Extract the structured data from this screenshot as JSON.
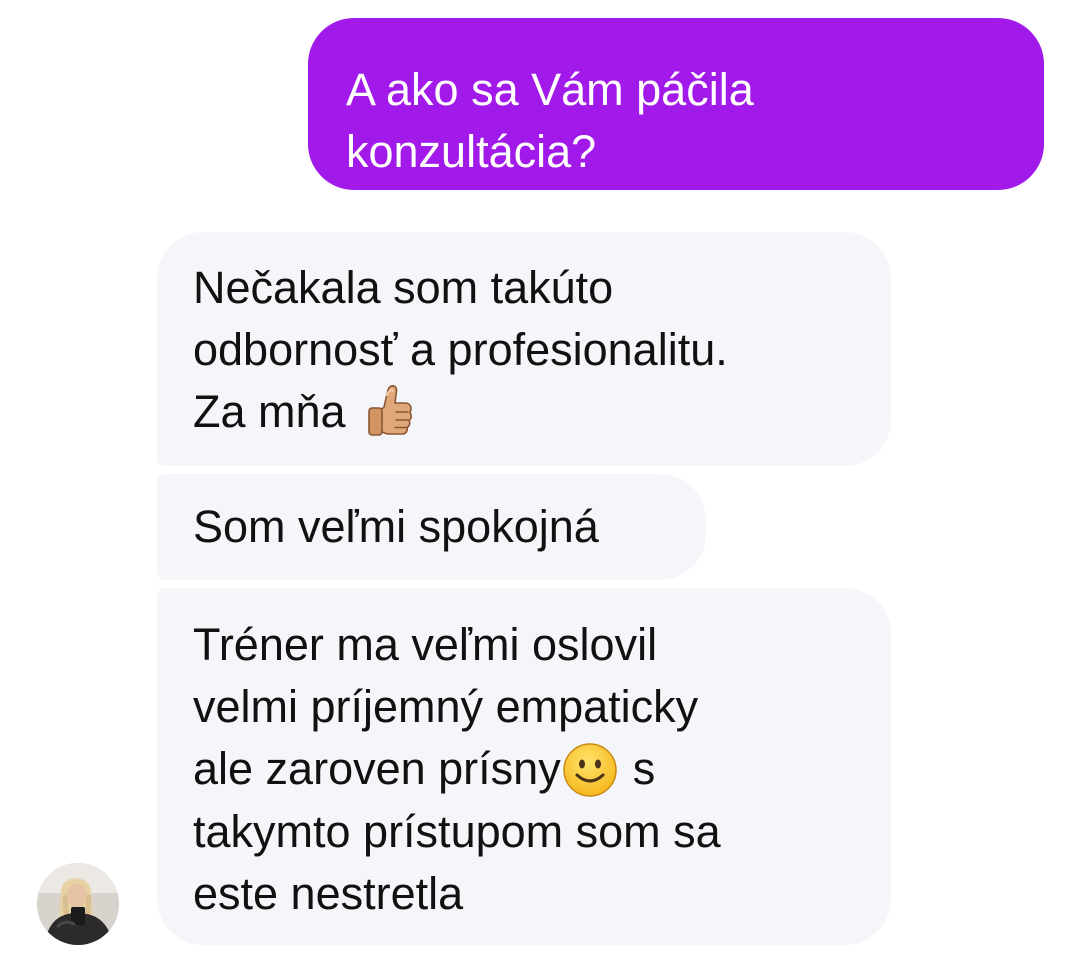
{
  "conversation": {
    "sent_message": {
      "lines": [
        "A ako sa Vám páčila",
        "konzultácia?"
      ]
    },
    "received_messages": [
      {
        "lines": [
          "Nečakala som takúto",
          "odbornosť a profesionalitu.",
          "Za mňa"
        ],
        "emoji": "thumbs-up"
      },
      {
        "lines": [
          "Som veľmi spokojná"
        ]
      },
      {
        "lines": [
          "Tréner ma veľmi oslovil",
          "velmi príjemný empaticky",
          "ale zaroven prísny",
          "s",
          "takymto prístupom som sa",
          "este nestretla"
        ],
        "emoji": "smiling-face"
      }
    ],
    "avatar": {
      "icon": "contact-avatar"
    }
  },
  "colors": {
    "sent_bubble": "#a21ae9",
    "received_bubble": "#f5f6f9",
    "sent_text": "#ffffff",
    "received_text": "#111111"
  }
}
